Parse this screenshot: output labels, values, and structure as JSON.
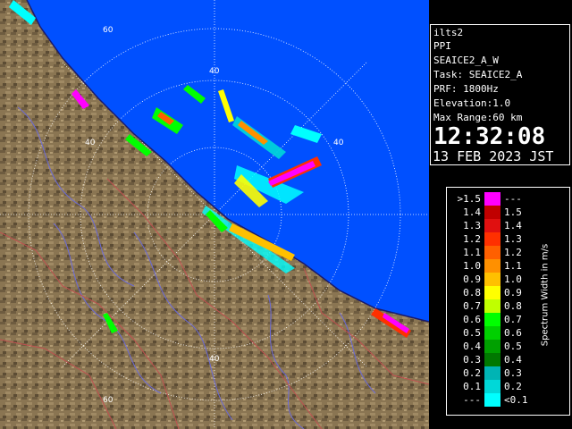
{
  "info_panel": {
    "site": "ilts2",
    "product": "PPI",
    "scan": "SEAICE2_A_W",
    "task": "Task: SEAICE2_A",
    "prf": "PRF: 1800Hz",
    "elevation": "Elevation:1.0",
    "max_range": "Max Range:60 km",
    "time": "12:32:08",
    "date": "13 FEB 2023 JST"
  },
  "legend": {
    "title": "Spectrum Width in m/s",
    "rows": [
      {
        "lo": ">1.5",
        "hi": "---",
        "color": "#ff00ff"
      },
      {
        "lo": "1.4",
        "hi": "1.5",
        "color": "#c00000"
      },
      {
        "lo": "1.3",
        "hi": "1.4",
        "color": "#e01010"
      },
      {
        "lo": "1.2",
        "hi": "1.3",
        "color": "#ff3000"
      },
      {
        "lo": "1.1",
        "hi": "1.2",
        "color": "#ff6000"
      },
      {
        "lo": "1.0",
        "hi": "1.1",
        "color": "#ff9000"
      },
      {
        "lo": "0.9",
        "hi": "1.0",
        "color": "#ffc000"
      },
      {
        "lo": "0.8",
        "hi": "0.9",
        "color": "#ffff00"
      },
      {
        "lo": "0.7",
        "hi": "0.8",
        "color": "#c0ff00"
      },
      {
        "lo": "0.6",
        "hi": "0.7",
        "color": "#00ff00"
      },
      {
        "lo": "0.5",
        "hi": "0.6",
        "color": "#00d000"
      },
      {
        "lo": "0.4",
        "hi": "0.5",
        "color": "#00a000"
      },
      {
        "lo": "0.3",
        "hi": "0.4",
        "color": "#007800"
      },
      {
        "lo": "0.2",
        "hi": "0.3",
        "color": "#00b4b4"
      },
      {
        "lo": "0.1",
        "hi": "0.2",
        "color": "#00d8d8"
      },
      {
        "lo": "---",
        "hi": "<0.1",
        "color": "#00ffff"
      }
    ]
  },
  "ring_labels": [
    "60",
    "40",
    "40",
    "40",
    "40",
    "60"
  ],
  "colors": {
    "sea": "#0050ff",
    "land": "#8a7552",
    "river": "#6a6ad8",
    "border": "#c05050",
    "range_ring": "#ffffff"
  }
}
